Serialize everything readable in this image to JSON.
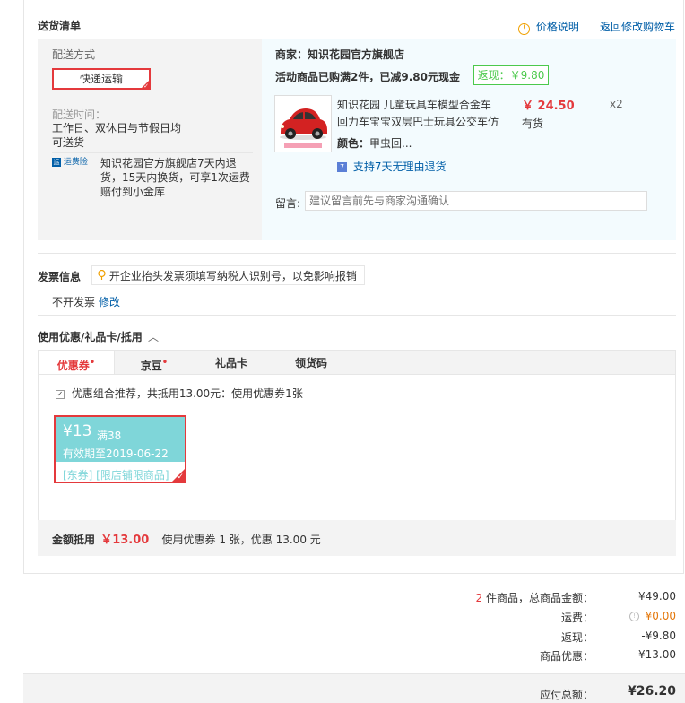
{
  "header": {
    "title": "送货清单",
    "price_note": "价格说明",
    "back_to_cart": "返回修改购物车"
  },
  "shipping": {
    "method_label": "配送方式",
    "method_value": "快递运输",
    "time_label": "配送时间：",
    "time_value_line1": "工作日、双休日与节假日均",
    "time_value_line2": "可送货",
    "insurance_badge": "运费险",
    "insurance_line1": "知识花园官方旗舰店7天内退",
    "insurance_line2": "货，15天内换货，可享1次运费",
    "insurance_line3": "赔付到小金库"
  },
  "store": {
    "name": "商家：知识花园官方旗舰店",
    "promo": "活动商品已购满2件，已减9.80元现金",
    "rebate": "返现：￥9.80",
    "product_title_line1": "知识花园 儿童玩具车模型合金车",
    "product_title_line2": "回力车宝宝双层巴士玩具公交车仿",
    "color_label": "颜色：",
    "color_value": "甲虫回...",
    "price": "￥ 24.50",
    "qty": "x2",
    "stock": "有货",
    "return_policy": "支持7天无理由退货",
    "remark_label": "留言:",
    "remark_placeholder": "建议留言前先与商家沟通确认"
  },
  "invoice": {
    "title": "发票信息",
    "tip": "开企业抬头发票须填写纳税人识别号，以免影响报销",
    "value": "不开发票",
    "edit": "修改"
  },
  "discount": {
    "title": "使用优惠/礼品卡/抵用",
    "tabs": [
      {
        "label": "优惠券",
        "dot": "•"
      },
      {
        "label": "京豆",
        "dot": "•"
      },
      {
        "label": "礼品卡",
        "dot": ""
      },
      {
        "label": "领货码",
        "dot": ""
      }
    ],
    "combo_text": "优惠组合推荐，共抵用13.00元：使用优惠券1张",
    "coupon": {
      "amount": "¥13",
      "condition": "满38",
      "expiry": "有效期至2019-06-22",
      "scope": "[东券] [限店铺限商品]"
    },
    "summary_label": "金额抵用",
    "summary_amount": "￥13.00",
    "summary_text": "使用优惠券 1 张，优惠 13.00 元"
  },
  "totals": {
    "count": "2",
    "count_suffix": "件商品，总商品金额：",
    "goods_amount": "¥49.00",
    "freight_label": "运费：",
    "freight_amount": "¥0.00",
    "rebate_label": "返现：",
    "rebate_amount": "-¥9.80",
    "discount_label": "商品优惠：",
    "discount_amount": "-¥13.00",
    "payable_label": "应付总额：",
    "payable_amount": "¥26.20"
  },
  "colors": {
    "accent_red": "#e4393c",
    "link_blue": "#005ea7",
    "coupon_teal": "#7fd6d9",
    "rebate_green": "#4cc94c",
    "freight_orange": "#e4780c"
  }
}
